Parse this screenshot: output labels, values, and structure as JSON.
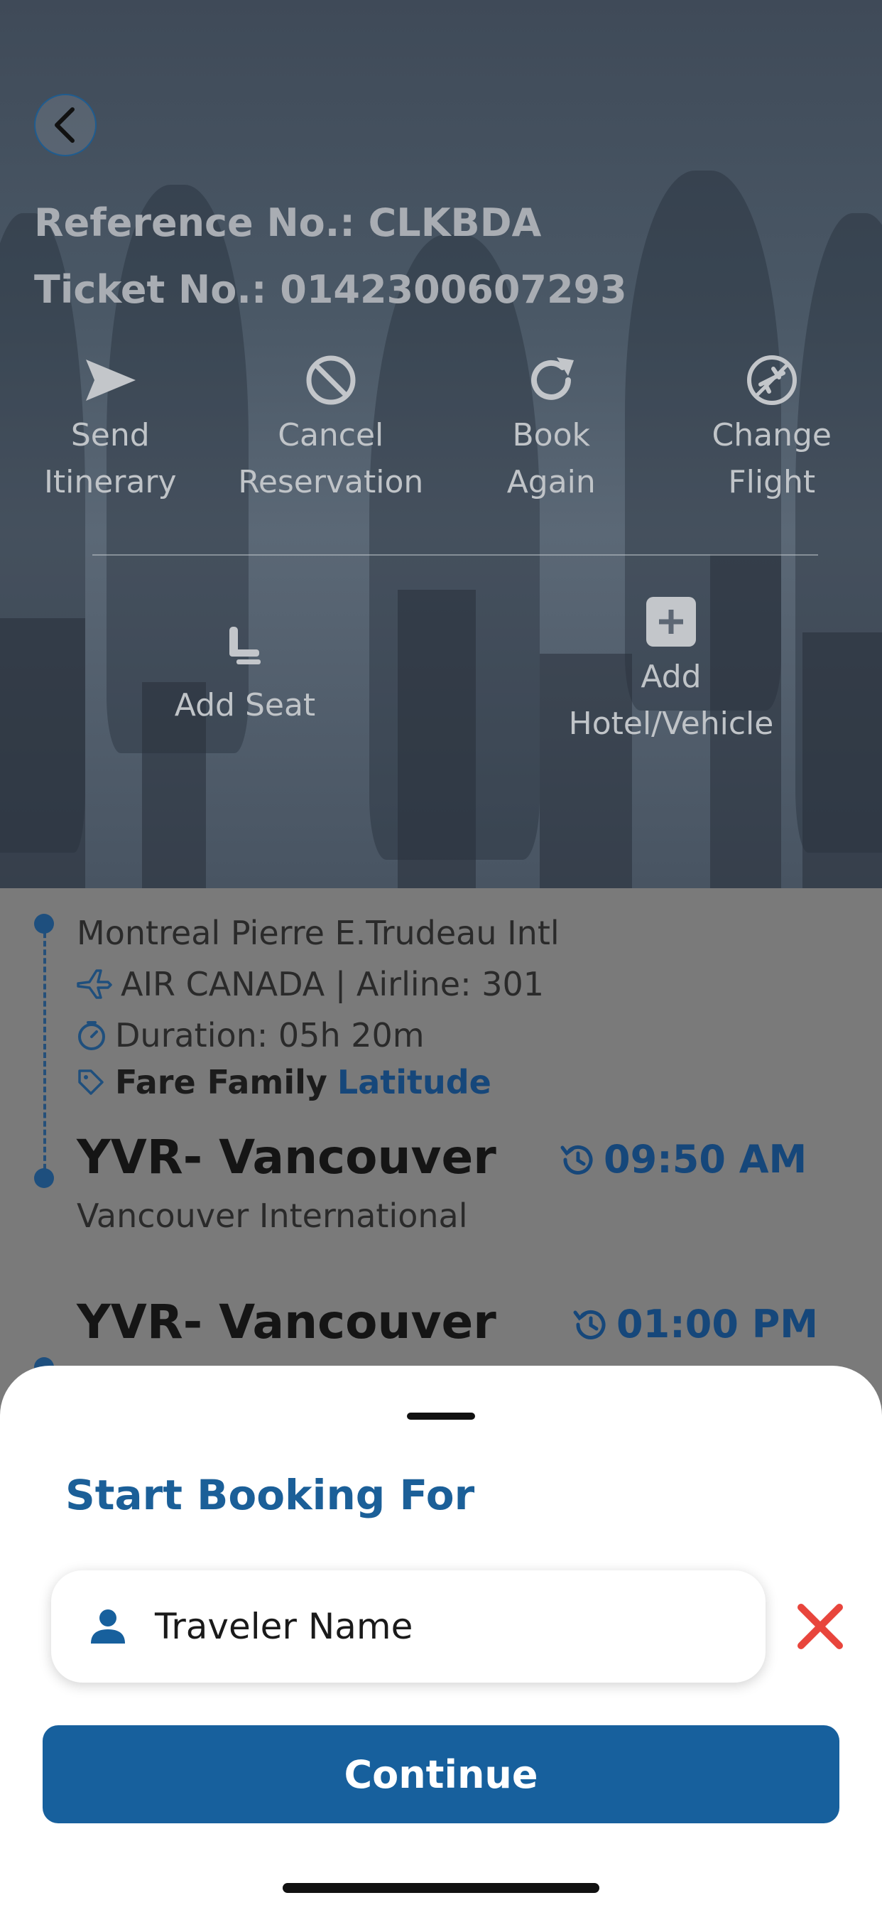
{
  "header": {
    "reference": "Reference No.: CLKBDA",
    "ticket": "Ticket No.: 0142300607293"
  },
  "actions": [
    {
      "icon": "send-icon",
      "label_line1": "Send",
      "label_line2": "Itinerary"
    },
    {
      "icon": "cancel-icon",
      "label_line1": "Cancel",
      "label_line2": "Reservation"
    },
    {
      "icon": "refresh-icon",
      "label_line1": "Book",
      "label_line2": "Again"
    },
    {
      "icon": "change-flight-icon",
      "label_line1": "Change",
      "label_line2": "Flight"
    }
  ],
  "actions2": [
    {
      "icon": "seat-icon",
      "label": "Add Seat"
    },
    {
      "icon": "plus-box-icon",
      "label_line1": "Add",
      "label_line2": "Hotel/Vehicle"
    }
  ],
  "itinerary": {
    "departure_airport": "Montreal Pierre E.Trudeau Intl",
    "airline": "AIR CANADA | Airline: 301",
    "duration": "Duration: 05h 20m",
    "fare_family_label": "Fare Family",
    "fare_family_value": "Latitude",
    "arrival_city": "YVR- Vancouver",
    "arrival_time": "09:50 AM",
    "arrival_airport": "Vancouver International",
    "next_city": "YVR- Vancouver",
    "next_time": "01:00 PM"
  },
  "sheet": {
    "title": "Start Booking For",
    "traveler_placeholder": "Traveler Name",
    "continue_label": "Continue"
  },
  "colors": {
    "primary": "#17609d",
    "close": "#e8453c"
  }
}
